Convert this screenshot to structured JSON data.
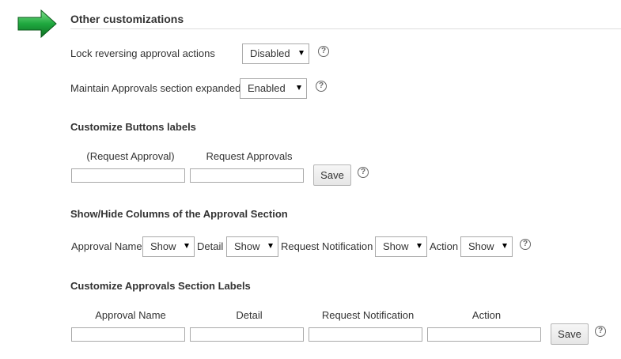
{
  "section": {
    "title": "Other customizations",
    "arrow_color": "#1a9a3a"
  },
  "lock_reversing": {
    "label": "Lock reversing approval actions",
    "value": "Disabled"
  },
  "maintain_expanded": {
    "label": "Maintain Approvals section expanded",
    "value": "Enabled"
  },
  "buttons_labels": {
    "heading": "Customize Buttons labels",
    "columns": [
      "(Request Approval)",
      "Request Approvals"
    ],
    "values": [
      "",
      ""
    ],
    "save_label": "Save"
  },
  "show_hide": {
    "heading": "Show/Hide Columns of the Approval Section",
    "items": [
      {
        "label": "Approval Name",
        "value": "Show"
      },
      {
        "label": "Detail",
        "value": "Show"
      },
      {
        "label": "Request Notification",
        "value": "Show"
      },
      {
        "label": "Action",
        "value": "Show"
      }
    ]
  },
  "section_labels": {
    "heading": "Customize Approvals Section Labels",
    "columns": [
      "Approval Name",
      "Detail",
      "Request Notification",
      "Action"
    ],
    "values": [
      "",
      "",
      "",
      ""
    ],
    "save_label": "Save"
  },
  "help_glyph": "?"
}
